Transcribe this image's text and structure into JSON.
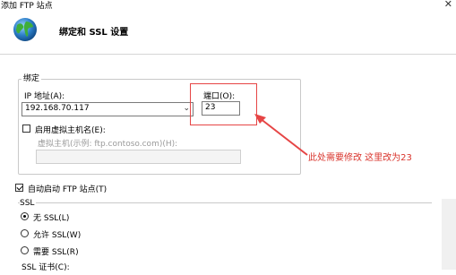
{
  "window": {
    "title": "添加 FTP 站点",
    "close_symbol": "✕"
  },
  "header": {
    "title": "绑定和 SSL 设置"
  },
  "binding": {
    "group_label": "绑定",
    "ip_label": "IP 地址(A):",
    "ip_value": "192.168.70.117",
    "port_label": "端口(O):",
    "port_value": "23",
    "virtual_host_enable_label": "启用虚拟主机名(E):",
    "virtual_host_label": "虚拟主机(示例: ftp.contoso.com)(H):",
    "virtual_host_value": ""
  },
  "auto_start": {
    "label": "自动启动 FTP 站点(T)",
    "checked": true
  },
  "ssl": {
    "group_label": "SSL",
    "options": [
      "无 SSL(L)",
      "允许 SSL(W)",
      "需要 SSL(R)"
    ],
    "selected": 0,
    "cert_label": "SSL 证书(C):"
  },
  "annotation": {
    "text": "此处需要修改  这里改为23",
    "color": "#d9332b"
  },
  "icons": {
    "globe": "globe-icon",
    "dropdown": "chevron-down-icon"
  }
}
